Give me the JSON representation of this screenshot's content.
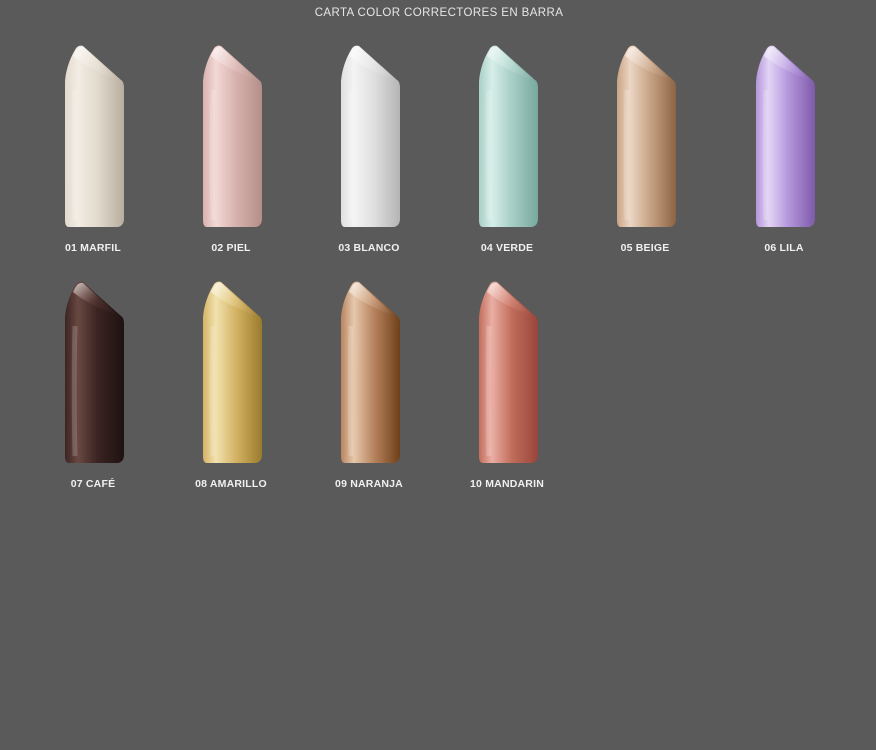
{
  "title": "CARTA COLOR CORRECTORES EN BARRA",
  "swatches": [
    {
      "label": "01 MARFIL",
      "colors": {
        "light": "#f2ece4",
        "mid": "#e2dacd",
        "dark": "#b8ae9f"
      }
    },
    {
      "label": "02 PIEL",
      "colors": {
        "light": "#f2d8d6",
        "mid": "#d8b2ae",
        "dark": "#b48e88"
      }
    },
    {
      "label": "03 BLANCO",
      "colors": {
        "light": "#f4f4f4",
        "mid": "#e0e0e0",
        "dark": "#b4b4b4"
      }
    },
    {
      "label": "04  VERDE",
      "colors": {
        "light": "#d6eee8",
        "mid": "#a8cfc6",
        "dark": "#78a89e"
      }
    },
    {
      "label": "05 BEIGE",
      "colors": {
        "light": "#ecd6c4",
        "mid": "#c8a486",
        "dark": "#8c6444"
      }
    },
    {
      "label": "06 LILA",
      "colors": {
        "light": "#e2d4f4",
        "mid": "#b496dc",
        "dark": "#7e5aaa"
      }
    },
    {
      "label": "07 CAFÉ",
      "colors": {
        "light": "#6a4842",
        "mid": "#3a2422",
        "dark": "#1e1210"
      }
    },
    {
      "label": "08 AMARILLO",
      "colors": {
        "light": "#f2e2b0",
        "mid": "#d4b464",
        "dark": "#9a7a2c"
      }
    },
    {
      "label": "09 NARANJA",
      "colors": {
        "light": "#e6c8ac",
        "mid": "#b88460",
        "dark": "#6e4018"
      }
    },
    {
      "label": "10 MANDARIN",
      "colors": {
        "light": "#eaaea4",
        "mid": "#c26e5c",
        "dark": "#98443a"
      }
    }
  ]
}
